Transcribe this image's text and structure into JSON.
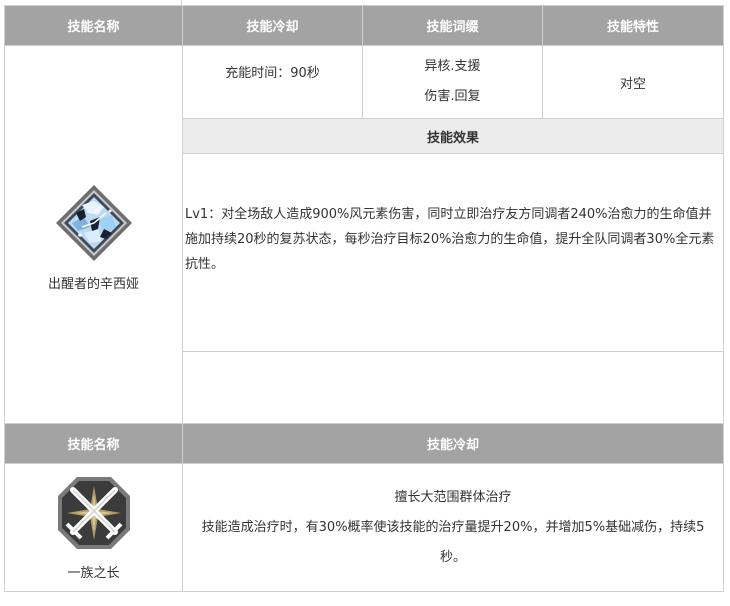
{
  "header1": {
    "col_name": "技能名称",
    "col_cd": "技能冷却",
    "col_tags": "技能词缀",
    "col_traits": "技能特性"
  },
  "skill1": {
    "name": "出醒者的辛西娅",
    "icon": "crystal-diamond-icon",
    "cooldown": "充能时间：90秒",
    "tags": [
      "异核.支援",
      "伤害.回复"
    ],
    "traits": "对空",
    "effect_header": "技能效果",
    "effect": "Lv1：对全场敌人造成900%风元素伤害，同时立即治疗友方同调者240%治愈力的生命值并施加持续20秒的复苏状态，每秒治疗目标20%治愈力的生命值，提升全队同调者30%全元素抗性。"
  },
  "header2": {
    "col_name": "技能名称",
    "col_cd": "技能冷却"
  },
  "skill2": {
    "name": "一族之长",
    "icon": "crossed-swords-icon",
    "title": "擅长大范围群体治疗",
    "desc": "技能造成治疗时，有30%概率使该技能的治疗量提升20%，并增加5%基础减伤，持续5秒。"
  },
  "colors": {
    "header_bg": "#a3a3a3",
    "subheader_bg": "#ececec",
    "border": "#cfcfcf"
  }
}
